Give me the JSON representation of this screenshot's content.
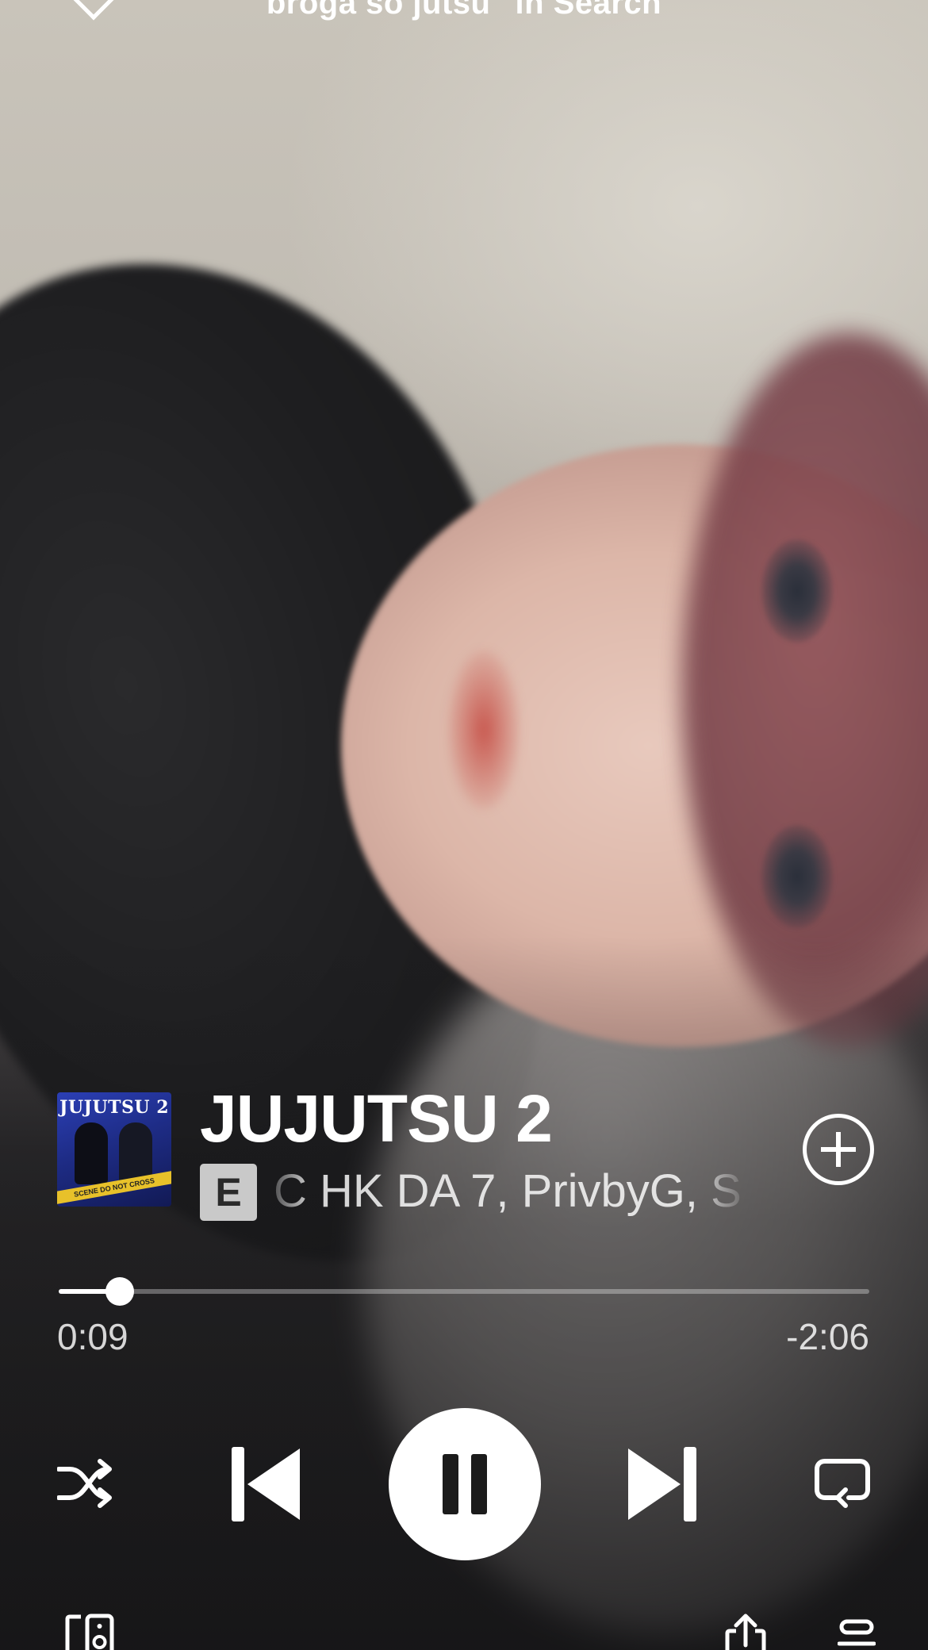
{
  "header": {
    "context_label": "broga so jutsu\" in Search"
  },
  "track": {
    "title": "JUJUTSU 2",
    "explicit_badge": "E",
    "artists": "C HK DA 7, PrivbyG, S",
    "album_art_title": "JUJUTSU 2",
    "album_art_caption": "SCENE DO NOT CROSS"
  },
  "playback": {
    "elapsed": "0:09",
    "remaining": "-2:06",
    "progress_fraction": 0.075,
    "state": "playing"
  },
  "colors": {
    "accent": "#ffffff",
    "explicit_badge_bg": "#c9c9c9"
  },
  "icons": {
    "collapse": "chevron-down-icon",
    "add": "add-circle-icon",
    "shuffle": "shuffle-icon",
    "previous": "skip-previous-icon",
    "pause": "pause-icon",
    "next": "skip-next-icon",
    "repeat": "repeat-icon",
    "devices": "connect-device-icon",
    "share": "share-icon",
    "queue": "queue-icon"
  }
}
